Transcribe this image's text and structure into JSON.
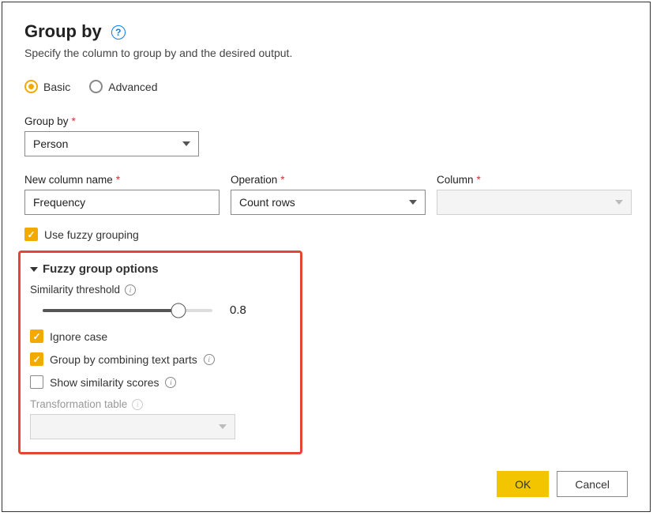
{
  "dialog": {
    "title": "Group by",
    "subtitle": "Specify the column to group by and the desired output."
  },
  "mode": {
    "basic_label": "Basic",
    "advanced_label": "Advanced",
    "selected": "basic"
  },
  "group_by": {
    "label": "Group by",
    "value": "Person"
  },
  "outputs": {
    "new_column_label": "New column name",
    "new_column_value": "Frequency",
    "operation_label": "Operation",
    "operation_value": "Count rows",
    "column_label": "Column",
    "column_value": ""
  },
  "fuzzy": {
    "use_label": "Use fuzzy grouping",
    "use_checked": true,
    "section_label": "Fuzzy group options",
    "threshold_label": "Similarity threshold",
    "threshold_value": "0.8",
    "ignore_case_label": "Ignore case",
    "ignore_case_checked": true,
    "combine_label": "Group by combining text parts",
    "combine_checked": true,
    "show_scores_label": "Show similarity scores",
    "show_scores_checked": false,
    "trans_table_label": "Transformation table",
    "trans_table_value": ""
  },
  "buttons": {
    "ok": "OK",
    "cancel": "Cancel"
  }
}
